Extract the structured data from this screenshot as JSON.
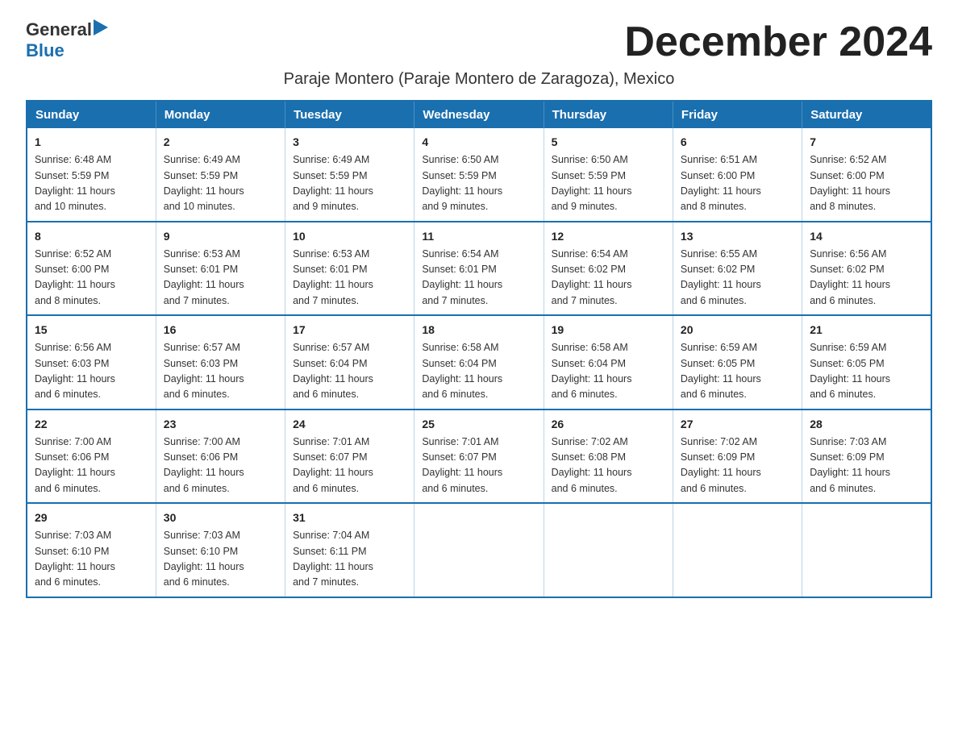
{
  "header": {
    "logo_general": "General",
    "logo_blue": "Blue",
    "month_title": "December 2024",
    "subtitle": "Paraje Montero (Paraje Montero de Zaragoza), Mexico"
  },
  "days_of_week": [
    "Sunday",
    "Monday",
    "Tuesday",
    "Wednesday",
    "Thursday",
    "Friday",
    "Saturday"
  ],
  "weeks": [
    [
      {
        "day": "1",
        "sunrise": "6:48 AM",
        "sunset": "5:59 PM",
        "daylight": "11 hours and 10 minutes."
      },
      {
        "day": "2",
        "sunrise": "6:49 AM",
        "sunset": "5:59 PM",
        "daylight": "11 hours and 10 minutes."
      },
      {
        "day": "3",
        "sunrise": "6:49 AM",
        "sunset": "5:59 PM",
        "daylight": "11 hours and 9 minutes."
      },
      {
        "day": "4",
        "sunrise": "6:50 AM",
        "sunset": "5:59 PM",
        "daylight": "11 hours and 9 minutes."
      },
      {
        "day": "5",
        "sunrise": "6:50 AM",
        "sunset": "5:59 PM",
        "daylight": "11 hours and 9 minutes."
      },
      {
        "day": "6",
        "sunrise": "6:51 AM",
        "sunset": "6:00 PM",
        "daylight": "11 hours and 8 minutes."
      },
      {
        "day": "7",
        "sunrise": "6:52 AM",
        "sunset": "6:00 PM",
        "daylight": "11 hours and 8 minutes."
      }
    ],
    [
      {
        "day": "8",
        "sunrise": "6:52 AM",
        "sunset": "6:00 PM",
        "daylight": "11 hours and 8 minutes."
      },
      {
        "day": "9",
        "sunrise": "6:53 AM",
        "sunset": "6:01 PM",
        "daylight": "11 hours and 7 minutes."
      },
      {
        "day": "10",
        "sunrise": "6:53 AM",
        "sunset": "6:01 PM",
        "daylight": "11 hours and 7 minutes."
      },
      {
        "day": "11",
        "sunrise": "6:54 AM",
        "sunset": "6:01 PM",
        "daylight": "11 hours and 7 minutes."
      },
      {
        "day": "12",
        "sunrise": "6:54 AM",
        "sunset": "6:02 PM",
        "daylight": "11 hours and 7 minutes."
      },
      {
        "day": "13",
        "sunrise": "6:55 AM",
        "sunset": "6:02 PM",
        "daylight": "11 hours and 6 minutes."
      },
      {
        "day": "14",
        "sunrise": "6:56 AM",
        "sunset": "6:02 PM",
        "daylight": "11 hours and 6 minutes."
      }
    ],
    [
      {
        "day": "15",
        "sunrise": "6:56 AM",
        "sunset": "6:03 PM",
        "daylight": "11 hours and 6 minutes."
      },
      {
        "day": "16",
        "sunrise": "6:57 AM",
        "sunset": "6:03 PM",
        "daylight": "11 hours and 6 minutes."
      },
      {
        "day": "17",
        "sunrise": "6:57 AM",
        "sunset": "6:04 PM",
        "daylight": "11 hours and 6 minutes."
      },
      {
        "day": "18",
        "sunrise": "6:58 AM",
        "sunset": "6:04 PM",
        "daylight": "11 hours and 6 minutes."
      },
      {
        "day": "19",
        "sunrise": "6:58 AM",
        "sunset": "6:04 PM",
        "daylight": "11 hours and 6 minutes."
      },
      {
        "day": "20",
        "sunrise": "6:59 AM",
        "sunset": "6:05 PM",
        "daylight": "11 hours and 6 minutes."
      },
      {
        "day": "21",
        "sunrise": "6:59 AM",
        "sunset": "6:05 PM",
        "daylight": "11 hours and 6 minutes."
      }
    ],
    [
      {
        "day": "22",
        "sunrise": "7:00 AM",
        "sunset": "6:06 PM",
        "daylight": "11 hours and 6 minutes."
      },
      {
        "day": "23",
        "sunrise": "7:00 AM",
        "sunset": "6:06 PM",
        "daylight": "11 hours and 6 minutes."
      },
      {
        "day": "24",
        "sunrise": "7:01 AM",
        "sunset": "6:07 PM",
        "daylight": "11 hours and 6 minutes."
      },
      {
        "day": "25",
        "sunrise": "7:01 AM",
        "sunset": "6:07 PM",
        "daylight": "11 hours and 6 minutes."
      },
      {
        "day": "26",
        "sunrise": "7:02 AM",
        "sunset": "6:08 PM",
        "daylight": "11 hours and 6 minutes."
      },
      {
        "day": "27",
        "sunrise": "7:02 AM",
        "sunset": "6:09 PM",
        "daylight": "11 hours and 6 minutes."
      },
      {
        "day": "28",
        "sunrise": "7:03 AM",
        "sunset": "6:09 PM",
        "daylight": "11 hours and 6 minutes."
      }
    ],
    [
      {
        "day": "29",
        "sunrise": "7:03 AM",
        "sunset": "6:10 PM",
        "daylight": "11 hours and 6 minutes."
      },
      {
        "day": "30",
        "sunrise": "7:03 AM",
        "sunset": "6:10 PM",
        "daylight": "11 hours and 6 minutes."
      },
      {
        "day": "31",
        "sunrise": "7:04 AM",
        "sunset": "6:11 PM",
        "daylight": "11 hours and 7 minutes."
      },
      null,
      null,
      null,
      null
    ]
  ],
  "labels": {
    "sunrise": "Sunrise:",
    "sunset": "Sunset:",
    "daylight": "Daylight:"
  }
}
